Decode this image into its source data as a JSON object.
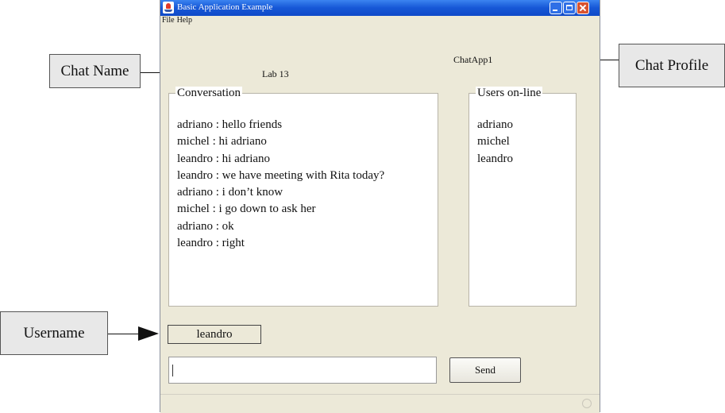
{
  "window": {
    "title": "Basic Application Example",
    "menu": [
      "File",
      "Help"
    ]
  },
  "chat": {
    "name": "Lab 13",
    "profile": "ChatApp1",
    "conversation_title": "Conversation",
    "messages": [
      "adriano : hello friends",
      "michel : hi adriano",
      "leandro : hi adriano",
      "leandro : we have meeting with Rita today?",
      "adriano : i don’t know",
      "michel : i go down to ask her",
      "adriano : ok",
      "leandro : right"
    ],
    "users_title": "Users on-line",
    "users": [
      "adriano",
      "michel",
      "leandro"
    ],
    "username": "leandro",
    "message_value": "",
    "send_label": "Send"
  },
  "callouts": {
    "chat_name": "Chat Name",
    "chat_profile": "Chat Profile",
    "username": "Username"
  }
}
